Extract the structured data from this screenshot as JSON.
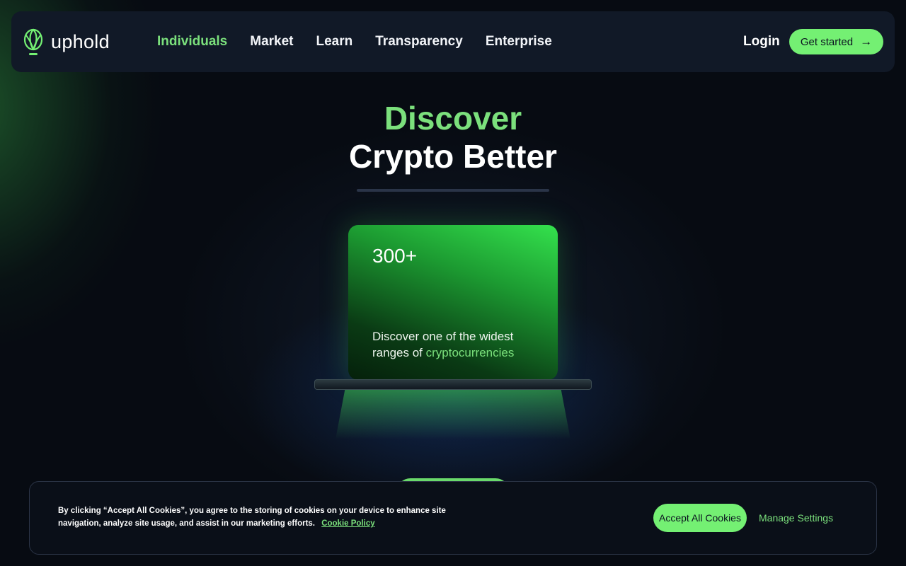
{
  "brand": {
    "name": "uphold",
    "accent": "#74f073"
  },
  "nav": {
    "links": [
      {
        "label": "Individuals",
        "active": true
      },
      {
        "label": "Market"
      },
      {
        "label": "Learn"
      },
      {
        "label": "Transparency"
      },
      {
        "label": "Enterprise"
      }
    ],
    "login_label": "Login",
    "cta_label": "Get started",
    "cta_icon": "arrow-right-icon"
  },
  "hero": {
    "title_line1": "Discover",
    "title_line2": "Crypto Better"
  },
  "card": {
    "count": "300+",
    "desc_prefix": "Discover one of the widest ranges of",
    "desc_highlight": "cryptocurrencies"
  },
  "cookie_banner": {
    "text": "By clicking “Accept All Cookies”, you agree to the storing of cookies on your device to enhance site navigation, analyze site usage, and assist in our marketing efforts.",
    "policy_link": "Cookie Policy",
    "accept_label": "Accept All Cookies",
    "manage_label": "Manage Settings"
  }
}
